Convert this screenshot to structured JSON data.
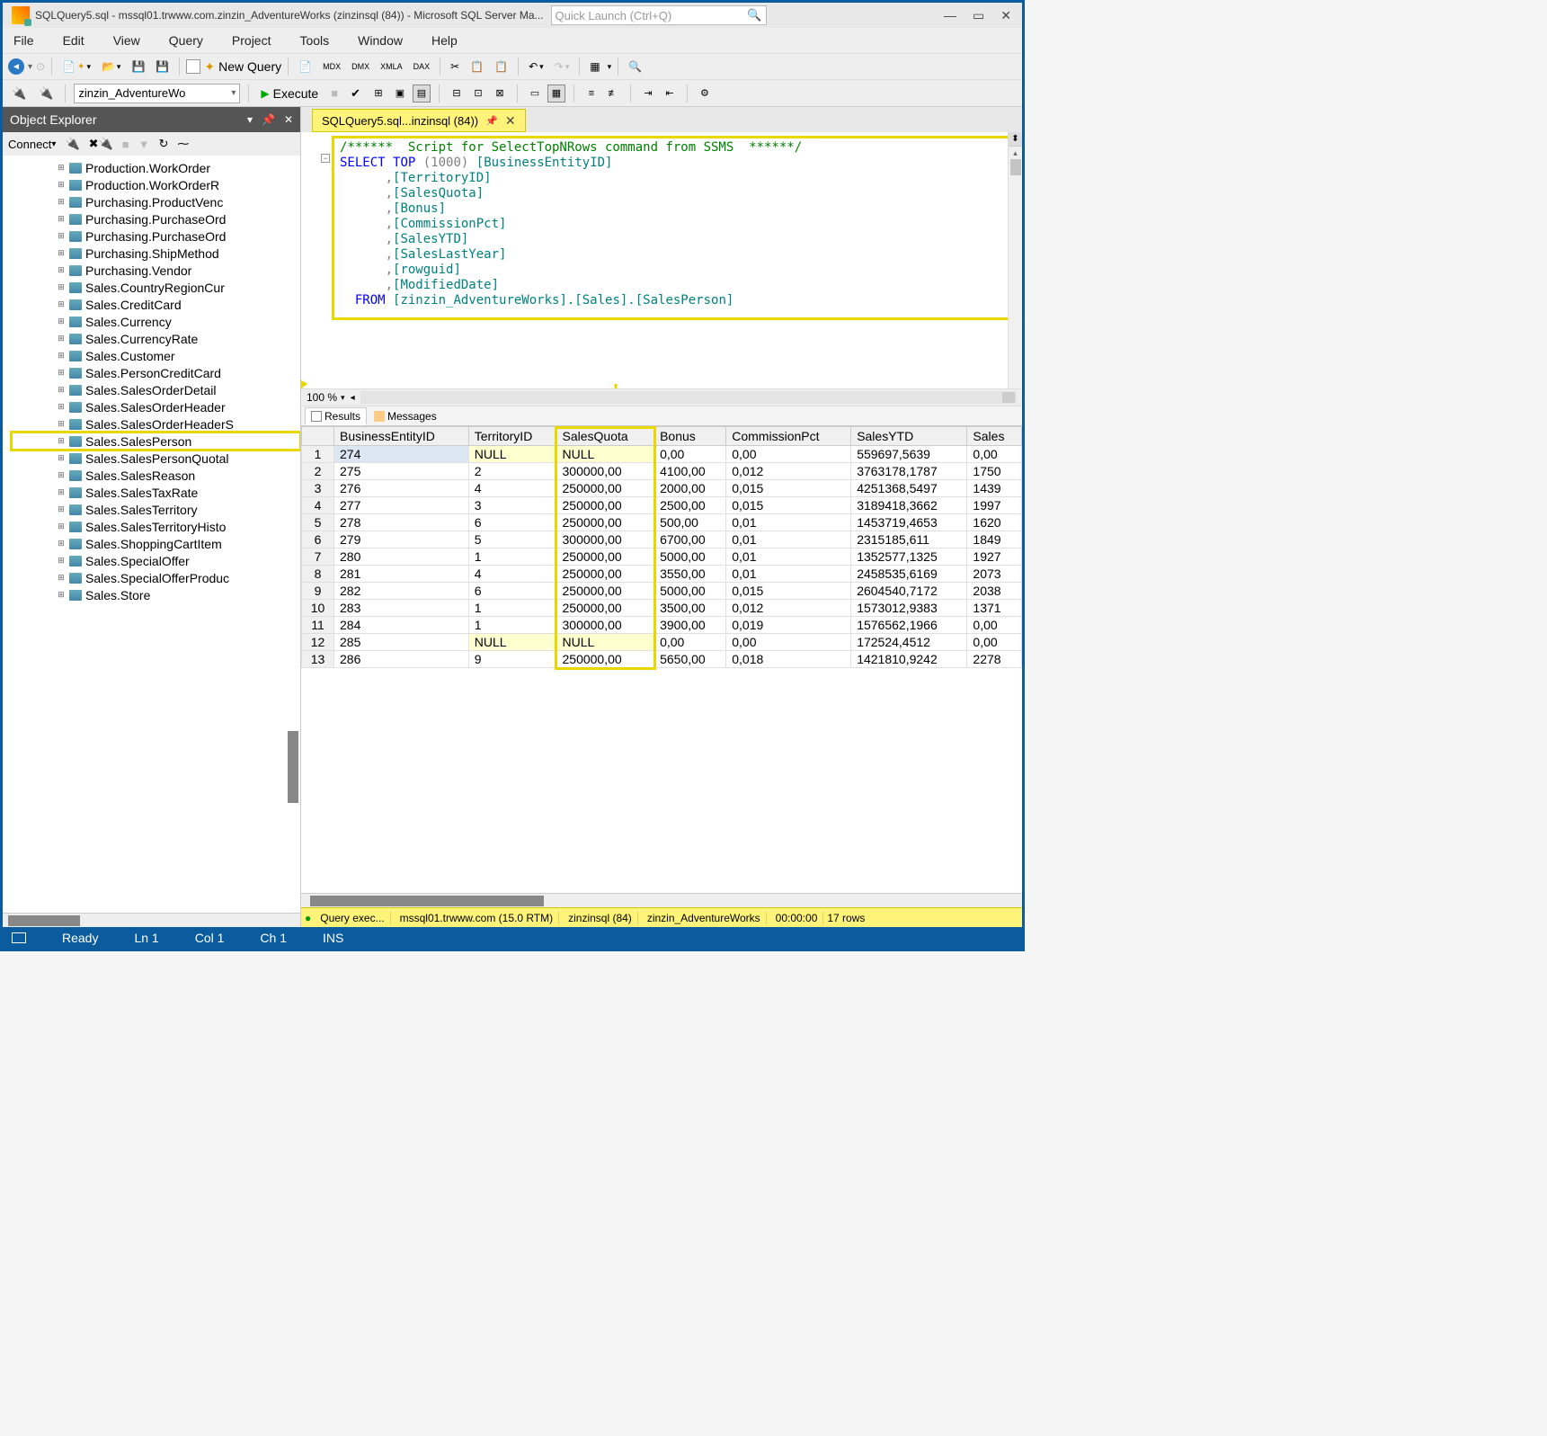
{
  "titlebar": {
    "text": "SQLQuery5.sql - mssql01.trwww.com.zinzin_AdventureWorks (zinzinsql (84)) - Microsoft SQL Server Ma...",
    "quicklaunch_placeholder": "Quick Launch (Ctrl+Q)"
  },
  "menubar": [
    "File",
    "Edit",
    "View",
    "Query",
    "Project",
    "Tools",
    "Window",
    "Help"
  ],
  "toolbar": {
    "new_query": "New Query"
  },
  "toolbar2": {
    "db": "zinzin_AdventureWo",
    "execute": "Execute"
  },
  "object_explorer": {
    "title": "Object Explorer",
    "connect": "Connect",
    "items": [
      "Production.WorkOrder",
      "Production.WorkOrderR",
      "Purchasing.ProductVenc",
      "Purchasing.PurchaseOrd",
      "Purchasing.PurchaseOrd",
      "Purchasing.ShipMethod",
      "Purchasing.Vendor",
      "Sales.CountryRegionCur",
      "Sales.CreditCard",
      "Sales.Currency",
      "Sales.CurrencyRate",
      "Sales.Customer",
      "Sales.PersonCreditCard",
      "Sales.SalesOrderDetail",
      "Sales.SalesOrderHeader",
      "Sales.SalesOrderHeaderS",
      "Sales.SalesPerson",
      "Sales.SalesPersonQuotal",
      "Sales.SalesReason",
      "Sales.SalesTaxRate",
      "Sales.SalesTerritory",
      "Sales.SalesTerritoryHisto",
      "Sales.ShoppingCartItem",
      "Sales.SpecialOffer",
      "Sales.SpecialOfferProduc",
      "Sales.Store"
    ],
    "highlighted_index": 16
  },
  "tab": {
    "label": "SQLQuery5.sql...inzinsql (84))"
  },
  "sql": {
    "line1_comment": "/******  Script for SelectTopNRows command from SSMS  ******/",
    "select": "SELECT",
    "top": "TOP",
    "topnum": "(1000)",
    "cols": [
      "[BusinessEntityID]",
      "[TerritoryID]",
      "[SalesQuota]",
      "[Bonus]",
      "[CommissionPct]",
      "[SalesYTD]",
      "[SalesLastYear]",
      "[rowguid]",
      "[ModifiedDate]"
    ],
    "from": "FROM",
    "schema": "[zinzin_AdventureWorks].[Sales].[SalesPerson]"
  },
  "zoom": "100 %",
  "results_tabs": {
    "results": "Results",
    "messages": "Messages"
  },
  "grid": {
    "headers": [
      "",
      "BusinessEntityID",
      "TerritoryID",
      "SalesQuota",
      "Bonus",
      "CommissionPct",
      "SalesYTD",
      "Sales"
    ],
    "rows": [
      [
        "1",
        "274",
        "NULL",
        "NULL",
        "0,00",
        "0,00",
        "559697,5639",
        "0,00"
      ],
      [
        "2",
        "275",
        "2",
        "300000,00",
        "4100,00",
        "0,012",
        "3763178,1787",
        "1750"
      ],
      [
        "3",
        "276",
        "4",
        "250000,00",
        "2000,00",
        "0,015",
        "4251368,5497",
        "1439"
      ],
      [
        "4",
        "277",
        "3",
        "250000,00",
        "2500,00",
        "0,015",
        "3189418,3662",
        "1997"
      ],
      [
        "5",
        "278",
        "6",
        "250000,00",
        "500,00",
        "0,01",
        "1453719,4653",
        "1620"
      ],
      [
        "6",
        "279",
        "5",
        "300000,00",
        "6700,00",
        "0,01",
        "2315185,611",
        "1849"
      ],
      [
        "7",
        "280",
        "1",
        "250000,00",
        "5000,00",
        "0,01",
        "1352577,1325",
        "1927"
      ],
      [
        "8",
        "281",
        "4",
        "250000,00",
        "3550,00",
        "0,01",
        "2458535,6169",
        "2073"
      ],
      [
        "9",
        "282",
        "6",
        "250000,00",
        "5000,00",
        "0,015",
        "2604540,7172",
        "2038"
      ],
      [
        "10",
        "283",
        "1",
        "250000,00",
        "3500,00",
        "0,012",
        "1573012,9383",
        "1371"
      ],
      [
        "11",
        "284",
        "1",
        "300000,00",
        "3900,00",
        "0,019",
        "1576562,1966",
        "0,00"
      ],
      [
        "12",
        "285",
        "NULL",
        "NULL",
        "0,00",
        "0,00",
        "172524,4512",
        "0,00"
      ],
      [
        "13",
        "286",
        "9",
        "250000,00",
        "5650,00",
        "0,018",
        "1421810,9242",
        "2278"
      ]
    ]
  },
  "status": {
    "query": "Query exec...",
    "server": "mssql01.trwww.com (15.0 RTM)",
    "user": "zinzinsql (84)",
    "db": "zinzin_AdventureWorks",
    "time": "00:00:00",
    "rows": "17 rows"
  },
  "footer": {
    "ready": "Ready",
    "ln": "Ln 1",
    "col": "Col 1",
    "ch": "Ch 1",
    "ins": "INS"
  }
}
